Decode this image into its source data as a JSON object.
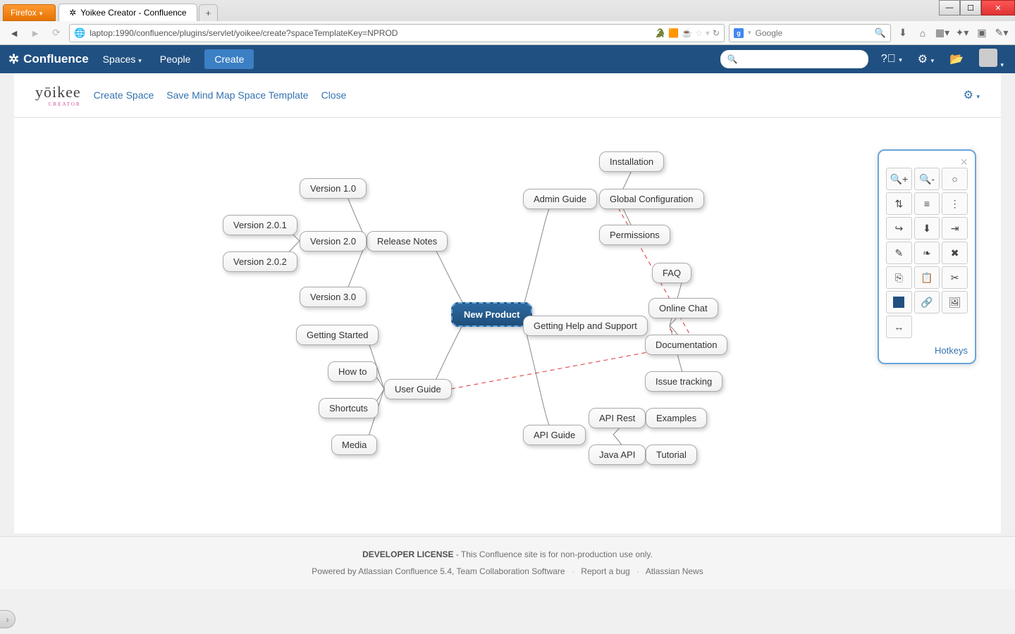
{
  "browser": {
    "name": "Firefox",
    "tab_title": "Yoikee Creator - Confluence",
    "tab_add": "+",
    "url": "laptop:1990/confluence/plugins/servlet/yoikee/create?spaceTemplateKey=NPROD",
    "search_placeholder": "Google",
    "win": {
      "min": "—",
      "max": "☐",
      "close": "✕"
    }
  },
  "confluence": {
    "logo": "Confluence",
    "menu_spaces": "Spaces",
    "menu_people": "People",
    "create": "Create"
  },
  "yoikee": {
    "logo_main": "yōikee",
    "logo_sub": "CREATOR",
    "link_create": "Create Space",
    "link_save": "Save Mind Map Space Template",
    "link_close": "Close"
  },
  "mindmap": {
    "root": "New Product",
    "release_notes": "Release Notes",
    "v10": "Version 1.0",
    "v20": "Version 2.0",
    "v201": "Version 2.0.1",
    "v202": "Version 2.0.2",
    "v30": "Version 3.0",
    "user_guide": "User Guide",
    "getting_started": "Getting Started",
    "how_to": "How to",
    "shortcuts": "Shortcuts",
    "media": "Media",
    "admin_guide": "Admin Guide",
    "installation": "Installation",
    "global_config": "Global Configuration",
    "permissions": "Permissions",
    "help_support": "Getting Help and Support",
    "faq": "FAQ",
    "online_chat": "Online Chat",
    "documentation": "Documentation",
    "issue_tracking": "Issue tracking",
    "api_guide": "API Guide",
    "api_rest": "API Rest",
    "java_api": "Java API",
    "examples": "Examples",
    "tutorial": "Tutorial"
  },
  "toolbox": {
    "hotkeys": "Hotkeys",
    "icons": [
      "zoom-in",
      "zoom-out",
      "zoom-fit",
      "tree",
      "list",
      "more",
      "export",
      "download",
      "import",
      "edit",
      "leaf",
      "delete",
      "copy",
      "paste",
      "cut",
      "color",
      "attach",
      "image",
      "arrow"
    ]
  },
  "footer": {
    "dev_license": "DEVELOPER LICENSE",
    "dev_text": " - This Confluence site is for non-production use only.",
    "powered": "Powered by Atlassian Confluence 5.4, Team Collaboration Software",
    "report": "Report a bug",
    "news": "Atlassian News"
  }
}
